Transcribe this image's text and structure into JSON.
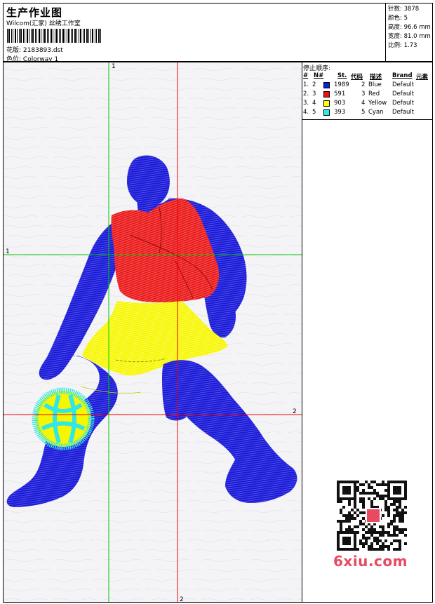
{
  "header": {
    "title": "生产作业图",
    "company": "Wilcom(汇家) 丝绣工作室",
    "design_label": "花版:",
    "design_value": "2183893.dst",
    "colorway_label": "色位:",
    "colorway_value": "Colorway 1"
  },
  "stats": [
    {
      "label": "针数:",
      "value": "3878"
    },
    {
      "label": "颜色:",
      "value": "5"
    },
    {
      "label": "高度:",
      "value": "96.6 mm"
    },
    {
      "label": "宽度:",
      "value": "81.0 mm"
    },
    {
      "label": "比例:",
      "value": "1.73"
    }
  ],
  "stop_sequence": {
    "title": "停止顺序:",
    "headers": [
      "#",
      "N#",
      "St.",
      "代码",
      "描述",
      "Brand",
      "元素"
    ],
    "rows": [
      {
        "idx": "1.",
        "n": "2",
        "color": "#0022dd",
        "st": "1989",
        "code": "2",
        "desc": "Blue",
        "brand": "Default"
      },
      {
        "idx": "2.",
        "n": "3",
        "color": "#ee1111",
        "st": "591",
        "code": "3",
        "desc": "Red",
        "brand": "Default"
      },
      {
        "idx": "3.",
        "n": "4",
        "color": "#ffff00",
        "st": "903",
        "code": "4",
        "desc": "Yellow",
        "brand": "Default"
      },
      {
        "idx": "4.",
        "n": "5",
        "color": "#22eeee",
        "st": "393",
        "code": "5",
        "desc": "Cyan",
        "brand": "Default"
      }
    ]
  },
  "guides": {
    "green_label": "1",
    "green_side_label": "1",
    "red_label": "2",
    "red_side_label": "2"
  },
  "colors": {
    "blue": "#1a1ad6",
    "red": "#e81818",
    "yellow": "#f6f600",
    "cyan": "#33e6e6",
    "green_guide": "#00cc00",
    "red_guide": "#ee0000"
  },
  "watermark": "6xiu.com"
}
